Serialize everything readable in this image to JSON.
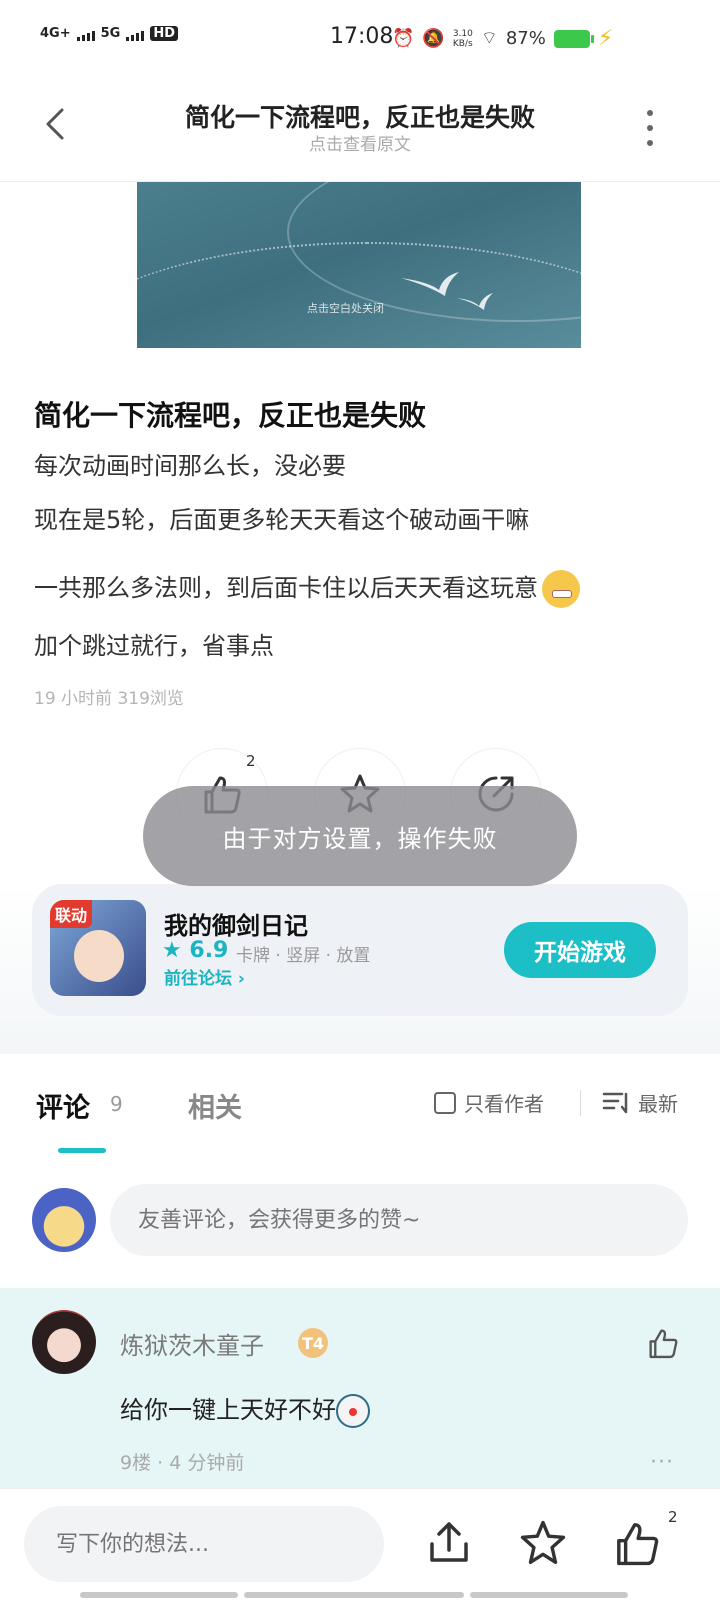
{
  "status_bar": {
    "net1": "4G+",
    "net2": "5G",
    "hd": "HD",
    "time": "17:08",
    "speed": "3.10\nKB/s",
    "battery": "87%"
  },
  "header": {
    "title": "简化一下流程吧，反正也是失败",
    "subtitle": "点击查看原文"
  },
  "banner": {
    "hint": "点击空白处关闭"
  },
  "post": {
    "title": "简化一下流程吧，反正也是失败",
    "lines": [
      "每次动画时间那么长，没必要",
      "现在是5轮，后面更多轮天天看这个破动画干嘛",
      "一共那么多法则，到后面卡住以后天天看这玩意",
      "加个跳过就行，省事点"
    ],
    "meta": "19 小时前  319浏览",
    "like_count": "2"
  },
  "toast": {
    "text": "由于对方设置，操作失败"
  },
  "game": {
    "badge": "联动",
    "name": "我的御剑日记",
    "rating": "★ 6.9",
    "tags": "卡牌 · 竖屏 · 放置",
    "forum": "前往论坛 ›",
    "play_label": "开始游戏"
  },
  "tabs": {
    "comments_label": "评论",
    "comments_count": "9",
    "related_label": "相关",
    "only_author": "只看作者",
    "sort": "最新"
  },
  "comment_input": {
    "placeholder": "友善评论，会获得更多的赞~"
  },
  "comment": {
    "user": "炼狱茨木童子",
    "level": "T4",
    "text": "给你一键上天好不好",
    "meta": "9楼 · 4 分钟前",
    "more": "···"
  },
  "bottom_bar": {
    "placeholder": "写下你的想法...",
    "like_count": "2"
  },
  "colors": {
    "accent": "#1cbfc6",
    "comment_bg": "#e6f6f7"
  }
}
